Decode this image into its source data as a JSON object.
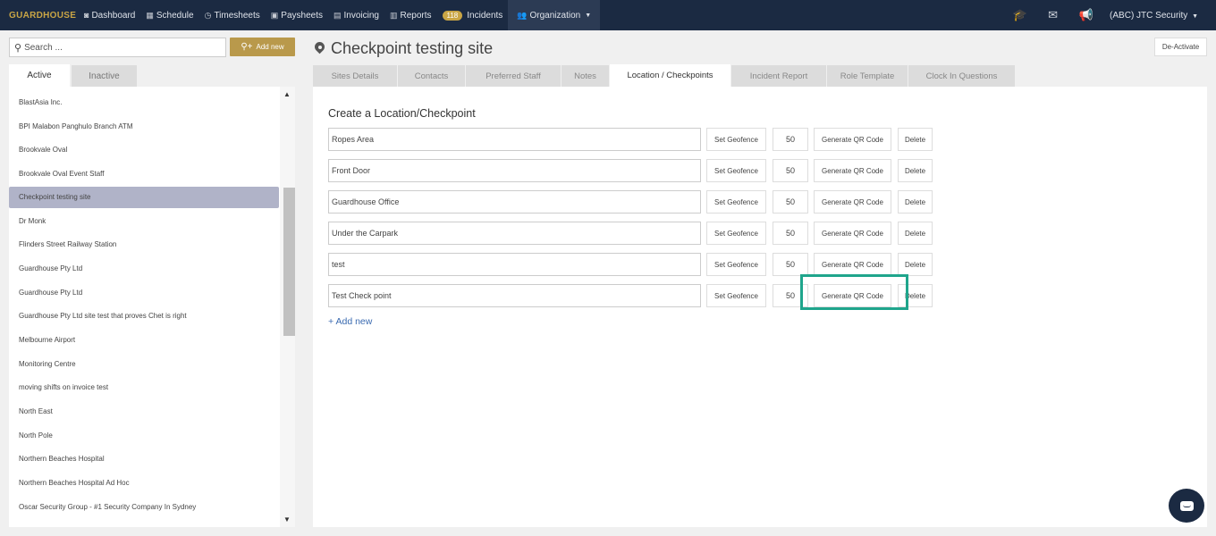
{
  "navbar": {
    "brand": "GUARDHOUSE",
    "items": [
      {
        "label": "Dashboard",
        "icon": "dashboard-icon",
        "glyph": "◙"
      },
      {
        "label": "Schedule",
        "icon": "calendar-icon",
        "glyph": "▦"
      },
      {
        "label": "Timesheets",
        "icon": "clock-icon",
        "glyph": "◷"
      },
      {
        "label": "Paysheets",
        "icon": "money-icon",
        "glyph": "▣"
      },
      {
        "label": "Invoicing",
        "icon": "invoice-icon",
        "glyph": "▤"
      },
      {
        "label": "Reports",
        "icon": "table-icon",
        "glyph": "▥"
      }
    ],
    "incidents": {
      "badge": "118",
      "label": "Incidents"
    },
    "organization": {
      "label": "Organization",
      "icon": "users-icon",
      "glyph": "👥"
    },
    "right": {
      "graduation_icon": "🎓",
      "mail_icon": "✉",
      "megaphone_icon": "📢",
      "org_name": "(ABC) JTC Security"
    }
  },
  "sidebar": {
    "search_placeholder": "Search ...",
    "add_new_label": "Add new",
    "tabs": {
      "active": "Active",
      "inactive": "Inactive"
    },
    "sites": [
      {
        "label": "BlastAsia Inc."
      },
      {
        "label": "BPI Malabon Panghulo Branch ATM"
      },
      {
        "label": "Brookvale Oval"
      },
      {
        "label": "Brookvale Oval Event Staff"
      },
      {
        "label": "Checkpoint testing site",
        "selected": true
      },
      {
        "label": "Dr Monk"
      },
      {
        "label": "Flinders Street Railway Station"
      },
      {
        "label": "Guardhouse Pty Ltd"
      },
      {
        "label": "Guardhouse Pty Ltd"
      },
      {
        "label": "Guardhouse Pty Ltd site test that proves Chet is right"
      },
      {
        "label": "Melbourne Airport"
      },
      {
        "label": "Monitoring Centre"
      },
      {
        "label": "moving shifts on invoice test"
      },
      {
        "label": "North East"
      },
      {
        "label": "North Pole"
      },
      {
        "label": "Northern Beaches Hospital"
      },
      {
        "label": "Northern Beaches Hospital Ad Hoc"
      },
      {
        "label": "Oscar Security Group - #1 Security Company In Sydney"
      }
    ]
  },
  "main": {
    "title": "Checkpoint testing site",
    "deactivate_label": "De-Activate",
    "tabs": [
      {
        "label": "Sites Details"
      },
      {
        "label": "Contacts"
      },
      {
        "label": "Preferred Staff"
      },
      {
        "label": "Notes"
      },
      {
        "label": "Location / Checkpoints",
        "active": true
      },
      {
        "label": "Incident Report"
      },
      {
        "label": "Role Template"
      },
      {
        "label": "Clock In Questions"
      }
    ],
    "section_heading": "Create a Location/Checkpoint",
    "buttons": {
      "geofence": "Set Geofence",
      "qr": "Generate QR Code",
      "delete": "Delete"
    },
    "checkpoints": [
      {
        "name": "Ropes Area",
        "radius": "50"
      },
      {
        "name": "Front Door",
        "radius": "50"
      },
      {
        "name": "Guardhouse Office",
        "radius": "50"
      },
      {
        "name": "Under the Carpark",
        "radius": "50"
      },
      {
        "name": "test",
        "radius": "50"
      },
      {
        "name": "Test Check point",
        "radius": "50"
      }
    ],
    "add_new_link": "+ Add new"
  },
  "colors": {
    "navbar_bg": "#1b2a42",
    "brand_gold": "#c9a545",
    "highlight": "#1fa58c",
    "selected_row": "#b0b3c8",
    "link": "#3a6ab0"
  }
}
